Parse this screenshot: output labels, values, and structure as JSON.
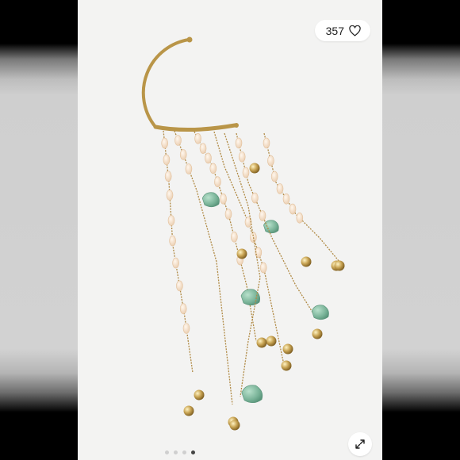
{
  "listing": {
    "like_count": "357",
    "heart_icon": "heart-outline-icon",
    "expand_icon": "expand-arrows-icon",
    "image_count": 4,
    "active_image": 4
  },
  "colors": {
    "photo_background": "#f3f3f2",
    "gold": "#b99548",
    "bead": "#f1d7bd",
    "stone": "#7fb59c"
  }
}
